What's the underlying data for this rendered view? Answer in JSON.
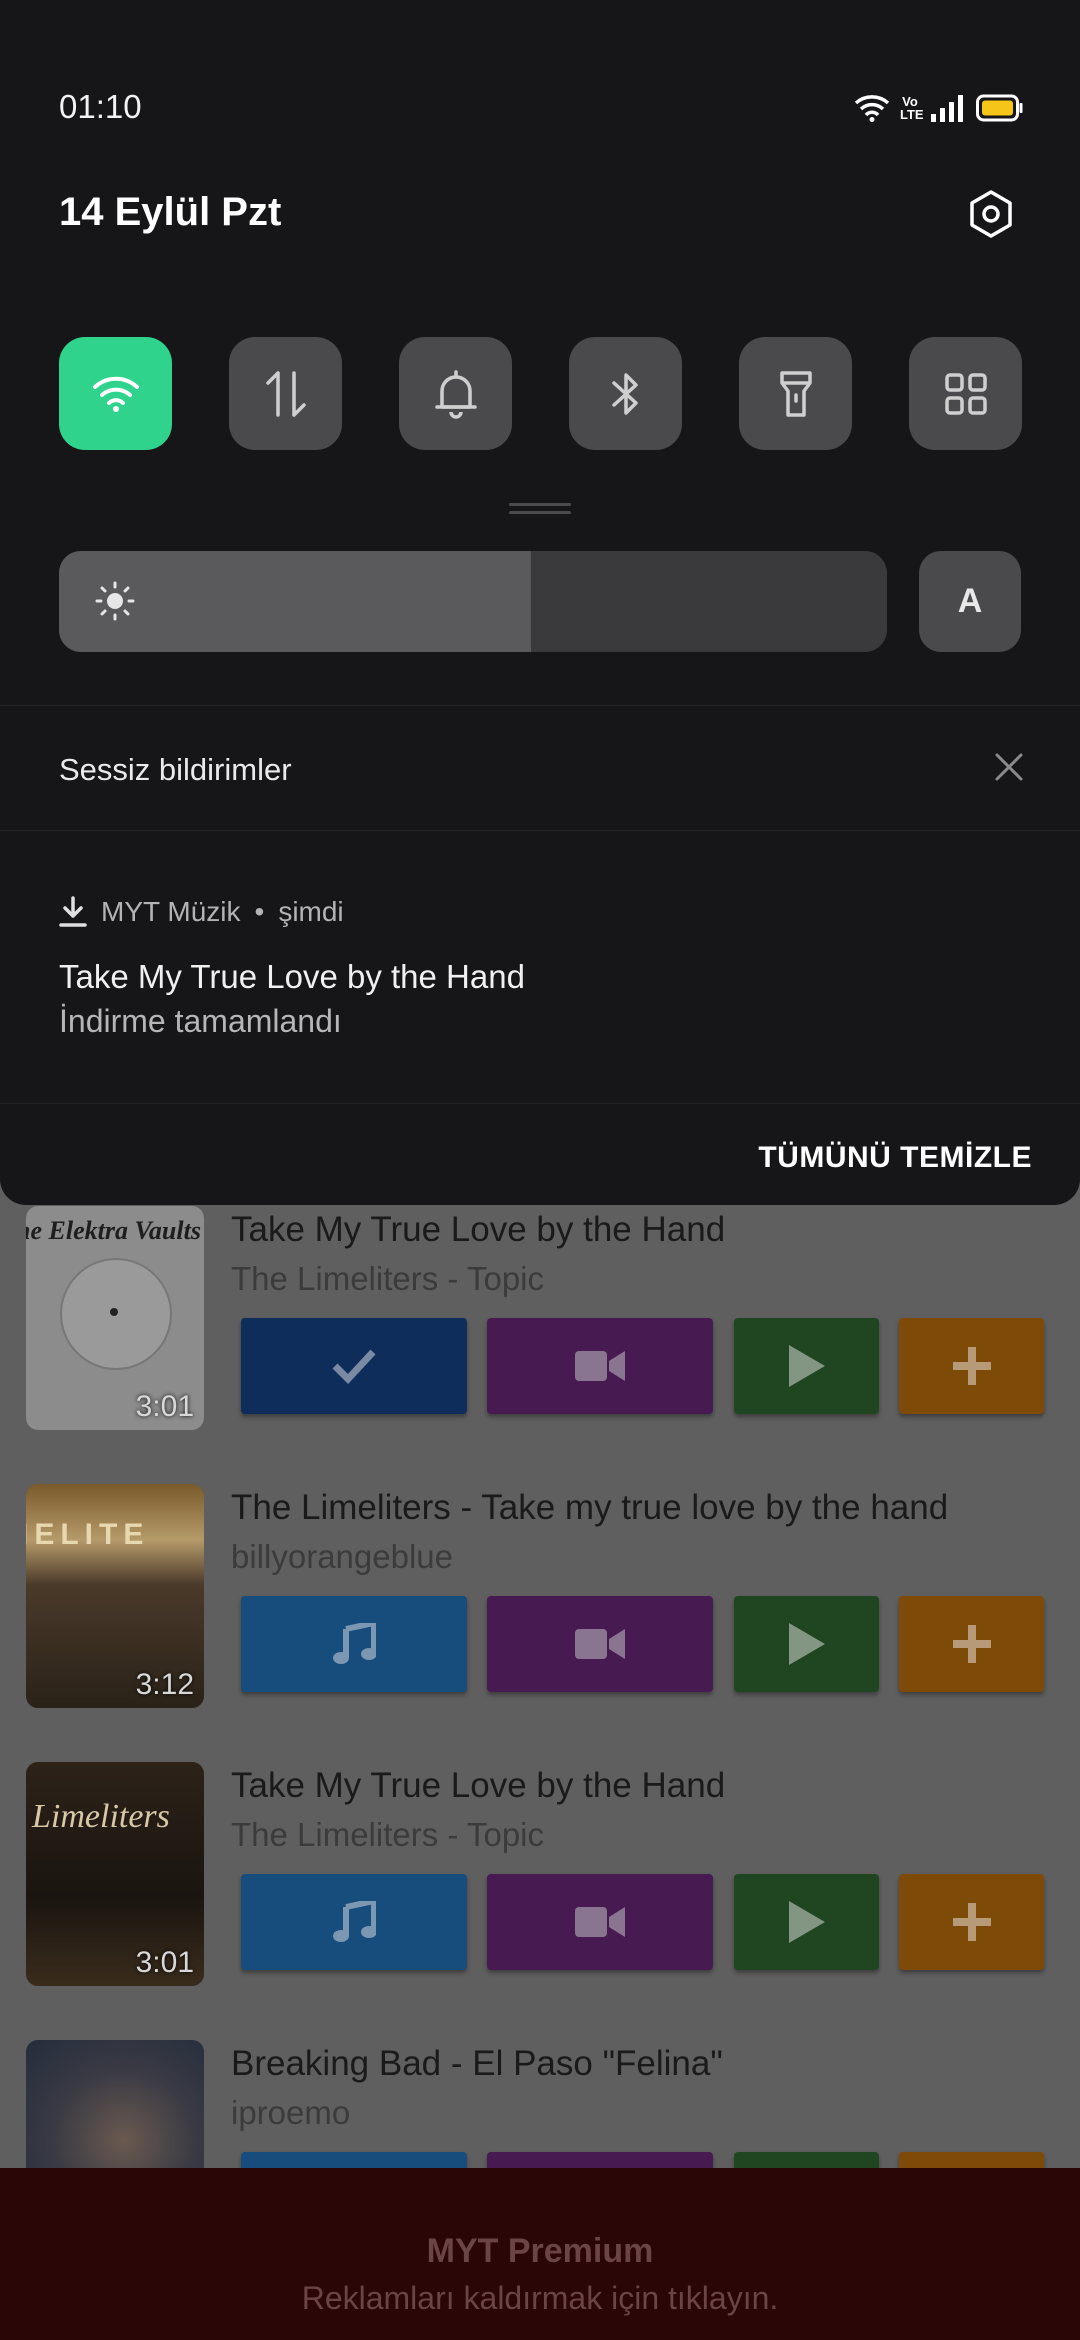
{
  "status_bar": {
    "time": "01:10",
    "volte": "Vo LTE"
  },
  "quick_settings": {
    "date": "14 Eylül Pzt",
    "tiles": [
      {
        "name": "wifi",
        "active": true,
        "icon": "wifi-icon"
      },
      {
        "name": "mobile-data",
        "active": false,
        "icon": "data-arrows-icon"
      },
      {
        "name": "sound",
        "active": false,
        "icon": "bell-icon"
      },
      {
        "name": "bluetooth",
        "active": false,
        "icon": "bluetooth-icon"
      },
      {
        "name": "flashlight",
        "active": false,
        "icon": "flashlight-icon"
      },
      {
        "name": "more",
        "active": false,
        "icon": "grid-icon"
      }
    ],
    "brightness_level": 0.57,
    "auto_brightness_label": "A"
  },
  "notifications": {
    "section_label": "Sessiz bildirimler",
    "items": [
      {
        "app": "MYT Müzik",
        "time": "şimdi",
        "separator": "•",
        "title": "Take My True Love by the Hand",
        "text": "İndirme tamamlandı"
      }
    ],
    "clear_all_label": "TÜMÜNÜ TEMİZLE"
  },
  "results": [
    {
      "title": "Take My True Love by the Hand",
      "subtitle": "The Limeliters - Topic",
      "duration": "3:01",
      "downloaded": true,
      "art_text": "he Elektra Vaults Ger"
    },
    {
      "title": "The Limeliters - Take my true love by the hand",
      "subtitle": "billyorangeblue",
      "duration": "3:12",
      "downloaded": false,
      "art_text": "IELITE"
    },
    {
      "title": "Take My True Love by the Hand",
      "subtitle": "The Limeliters - Topic",
      "duration": "3:01",
      "downloaded": false,
      "art_text": "Limeliters"
    },
    {
      "title": "Breaking Bad - El Paso \"Felina\"",
      "subtitle": "iproemo",
      "duration": "",
      "downloaded": false,
      "art_text": ""
    }
  ],
  "premium": {
    "title": "MYT Premium",
    "subtitle": "Reklamları kaldırmak için tıklayın."
  },
  "colors": {
    "wifi_active": "#2fd38b",
    "tile": "#4a4a4c",
    "shade": "#161618"
  }
}
